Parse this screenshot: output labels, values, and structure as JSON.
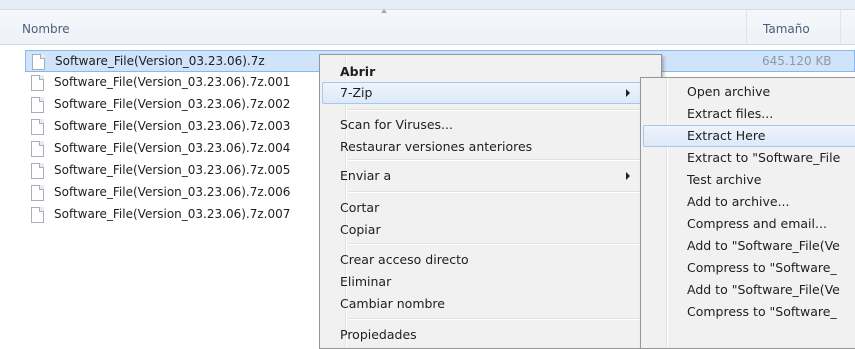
{
  "header": {
    "name_col": "Nombre",
    "size_col": "Tamaño"
  },
  "files": [
    {
      "name": "Software_File(Version_03.23.06).7z",
      "size": "645.120 KB"
    },
    {
      "name": "Software_File(Version_03.23.06).7z.001",
      "size": ""
    },
    {
      "name": "Software_File(Version_03.23.06).7z.002",
      "size": ""
    },
    {
      "name": "Software_File(Version_03.23.06).7z.003",
      "size": ""
    },
    {
      "name": "Software_File(Version_03.23.06).7z.004",
      "size": ""
    },
    {
      "name": "Software_File(Version_03.23.06).7z.005",
      "size": ""
    },
    {
      "name": "Software_File(Version_03.23.06).7z.006",
      "size": ""
    },
    {
      "name": "Software_File(Version_03.23.06).7z.007",
      "size": ""
    }
  ],
  "context_menu": {
    "open": "Abrir",
    "sevenzip": "7-Zip",
    "scan": "Scan for Viruses...",
    "restore": "Restaurar versiones anteriores",
    "send_to": "Enviar a",
    "cut": "Cortar",
    "copy": "Copiar",
    "shortcut": "Crear acceso directo",
    "delete": "Eliminar",
    "rename": "Cambiar nombre",
    "properties": "Propiedades"
  },
  "submenu": {
    "open_archive": "Open archive",
    "extract_files": "Extract files...",
    "extract_here": "Extract Here",
    "extract_to": "Extract to \"Software_File",
    "test_archive": "Test archive",
    "add_to_archive": "Add to archive...",
    "compress_email": "Compress and email...",
    "add_to_7z": "Add to \"Software_File(Ve",
    "compress_to_7z": "Compress to \"Software_",
    "add_to_zip": "Add to \"Software_File(Ve",
    "compress_to_zip": "Compress to \"Software_"
  },
  "colors": {
    "selection": "#cfe3fb",
    "menu_bg": "#f1f1f1",
    "header_text": "#4c607a"
  }
}
